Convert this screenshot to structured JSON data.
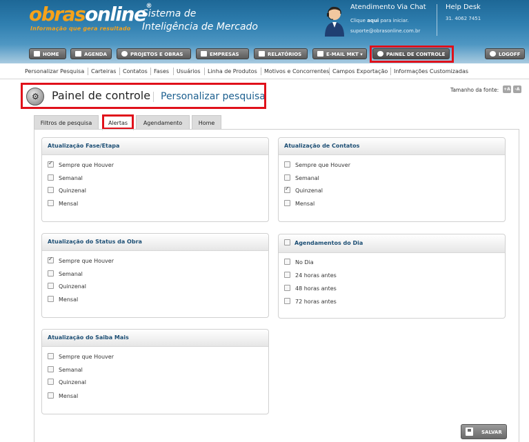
{
  "header": {
    "logo_part1": "obras",
    "logo_part2": "online",
    "logo_reg": "®",
    "tagline": "Informação que gera resultado",
    "system_line1": "Sistema de",
    "system_line2": "Inteligência de Mercado",
    "chat_title": "Atendimento Via Chat",
    "chat_click": "Clique",
    "chat_aqui": "aqui",
    "chat_rest": "para iniciar.",
    "chat_email": "suporte@obrasonline.com.br",
    "help_title": "Help Desk",
    "help_phone": "31. 4062 7451"
  },
  "nav": {
    "home": "HOME",
    "agenda": "AGENDA",
    "projetos": "PROJETOS E OBRAS",
    "empresas": "EMPRESAS",
    "relatorios": "RELATÓRIOS",
    "email": "E-MAIL MKT",
    "email_arrow": "▾",
    "painel": "PAINEL DE CONTROLE",
    "logoff": "LOGOFF"
  },
  "submenu": {
    "items": [
      "Personalizar Pesquisa",
      "Carteiras",
      "Contatos",
      "Fases",
      "Usuários",
      "Linha de Produtos",
      "Motivos e Concorrentes",
      "Campos Exportação",
      "Informações Customizadas"
    ]
  },
  "page": {
    "title": "Painel de controle",
    "subtitle": "Personalizar pesquisa",
    "font_size_label": "Tamanho da fonte:",
    "font_plus": "+A",
    "font_minus": "-A"
  },
  "tabs": [
    "Filtros de pesquisa",
    "Alertas",
    "Agendamento",
    "Home"
  ],
  "active_tab": "Alertas",
  "panels": {
    "fase": {
      "title": "Atualização Fase/Etapa",
      "options": [
        "Sempre que Houver",
        "Semanal",
        "Quinzenal",
        "Mensal"
      ],
      "checked": "Sempre que Houver"
    },
    "contatos": {
      "title": "Atualização de Contatos",
      "options": [
        "Sempre que Houver",
        "Semanal",
        "Quinzenal",
        "Mensal"
      ],
      "checked": "Quinzenal"
    },
    "status": {
      "title": "Atualização do Status da Obra",
      "options": [
        "Sempre que Houver",
        "Semanal",
        "Quinzenal",
        "Mensal"
      ],
      "checked": "Sempre que Houver"
    },
    "agendamentos": {
      "title": "Agendamentos do Dia",
      "options": [
        "No Dia",
        "24 horas antes",
        "48 horas antes",
        "72 horas antes"
      ],
      "checked": ""
    },
    "saiba": {
      "title": "Atualização do Saiba Mais",
      "options": [
        "Sempre que Houver",
        "Semanal",
        "Quinzenal",
        "Mensal"
      ],
      "checked": ""
    }
  },
  "save_label": "SALVAR",
  "colors": {
    "header_top": "#1d6796",
    "brand_orange": "#f6a21a",
    "panel_title": "#1c4e74",
    "highlight_red": "#e0101a"
  }
}
